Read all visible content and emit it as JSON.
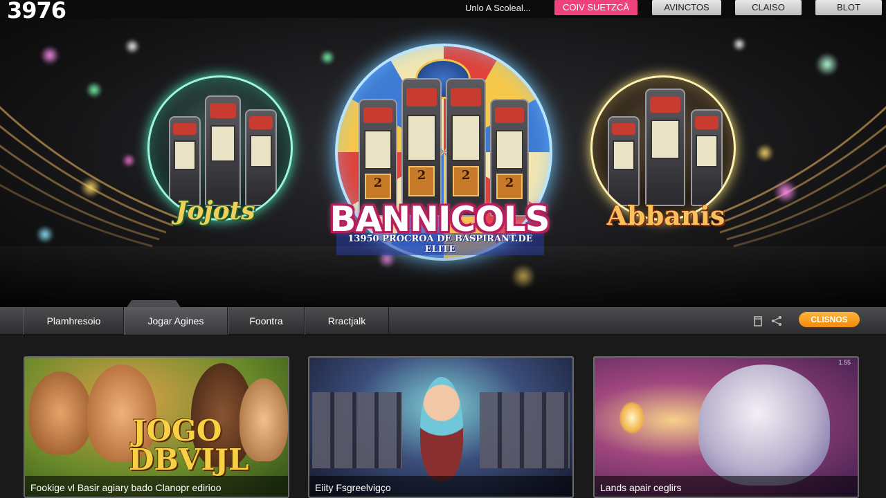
{
  "header": {
    "logo": "3976",
    "link": "Unlo A Scoleal...",
    "primary_button": "COIV SUETZCĂ",
    "buttons": [
      "AVINCTOS",
      "CLAISO",
      "BLOT"
    ]
  },
  "hero": {
    "left_label": "Jojots",
    "center_label": "BANNICOLS",
    "center_subtitle": "13950 PROCROA DE BASPIRANT.DE ELITE",
    "right_label": "Abbanis",
    "center_slot_numbers": [
      "2",
      "2",
      "2"
    ]
  },
  "nav": {
    "tabs": [
      "Plamhresoio",
      "Jogar Agines",
      "Foontra",
      "Rractjalk"
    ],
    "cta": "CLISNOS",
    "icons": [
      "list-icon",
      "share-icon"
    ]
  },
  "cards": [
    {
      "title": "JOGO DBVIJL",
      "caption": "Fookige vl Basir agiary bado Clanopr edirioo"
    },
    {
      "title": "",
      "caption": "Eiity Fsgreelvigço"
    },
    {
      "title": "",
      "caption": "Lands apair ceglirs",
      "badge": "1.55"
    }
  ],
  "colors": {
    "accent_pink": "#f0427e",
    "accent_orange": "#f4a51c",
    "bg": "#141414"
  }
}
